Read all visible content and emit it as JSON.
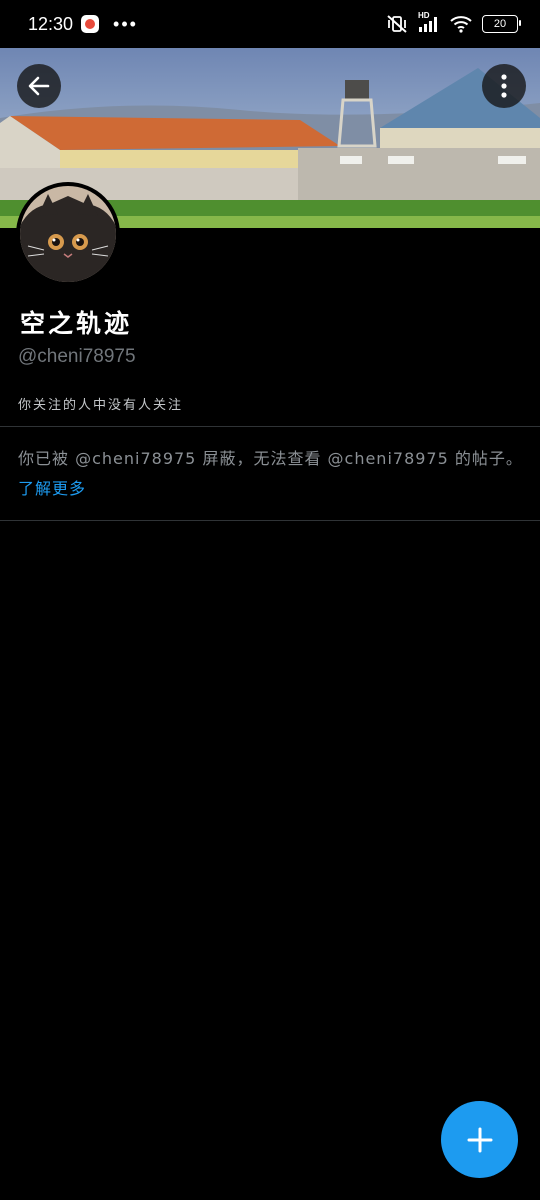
{
  "status_bar": {
    "time": "12:30",
    "dots": "•••",
    "battery": "20",
    "network": "HD"
  },
  "banner": {
    "back_icon": "arrow-left-icon",
    "more_icon": "more-vertical-icon"
  },
  "profile": {
    "name": "空之轨迹",
    "handle": "@cheni78975",
    "follow_note": "你关注的人中没有人关注"
  },
  "blocked_notice": {
    "text": "你已被 @cheni78975 屏蔽，无法查看 @cheni78975 的帖子。",
    "link": "了解更多"
  },
  "fab": {
    "icon": "plus-icon"
  },
  "colors": {
    "accent": "#1d9bf0",
    "background": "#000000",
    "muted": "#71767b"
  }
}
